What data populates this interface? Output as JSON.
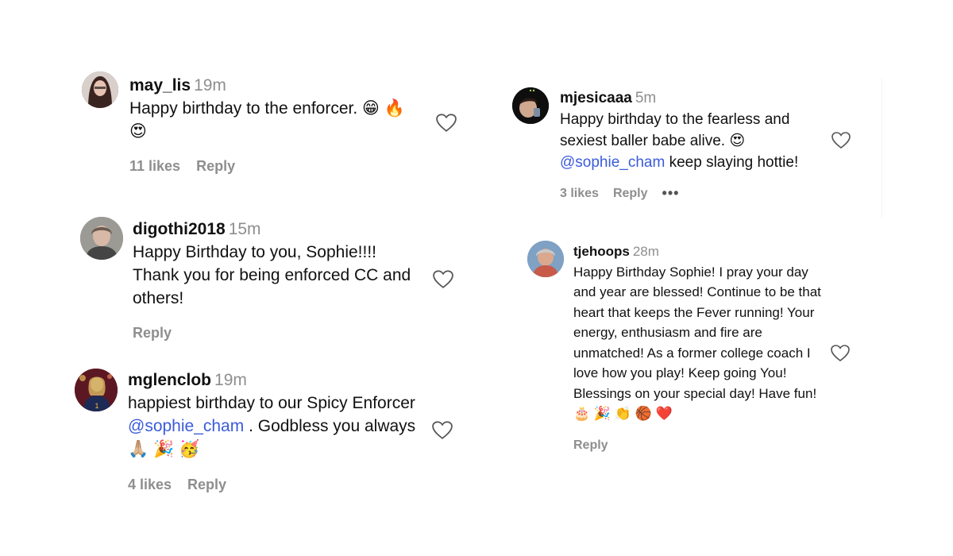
{
  "comments": [
    {
      "username": "may_lis",
      "time": "19m",
      "text": "Happy birthday to the enforcer. 😁 🔥 😍",
      "likes": "11 likes",
      "reply": "Reply",
      "heart_icon": "heart-outline-icon"
    },
    {
      "username": "digothi2018",
      "time": "15m",
      "text": "Happy Birthday to you, Sophie!!!! Thank you for being enforced CC and others!",
      "reply": "Reply",
      "heart_icon": "heart-outline-icon"
    },
    {
      "username": "mglenclob",
      "time": "19m",
      "text_before": "happiest birthday to our Spicy Enforcer ",
      "mention": "@sophie_cham",
      "text_after": " . Godbless you always🙏🏼 🎉 🥳",
      "likes": "4 likes",
      "reply": "Reply",
      "heart_icon": "heart-outline-icon"
    },
    {
      "username": "mjesicaaa",
      "time": "5m",
      "text_before": "Happy birthday to the fearless and sexiest baller babe alive. 😍 ",
      "mention": "@sophie_cham",
      "text_after": " keep slaying hottie!",
      "likes": "3 likes",
      "reply": "Reply",
      "more": "•••",
      "heart_icon": "heart-outline-icon"
    },
    {
      "username": "tjehoops",
      "time": "28m",
      "text": "Happy Birthday Sophie! I pray your day and year are blessed! Continue to be that heart that keeps the Fever running! Your energy, enthusiasm and fire are unmatched! As a former college coach I love how you play! Keep going You! Blessings on your special day! Have fun!🎂 🎉 👏 🏀 ❤️",
      "reply": "Reply",
      "heart_icon": "heart-outline-icon"
    }
  ],
  "colors": {
    "text": "#111111",
    "muted": "#8e8e8e",
    "mention": "#3b5bdb",
    "background": "#ffffff"
  }
}
